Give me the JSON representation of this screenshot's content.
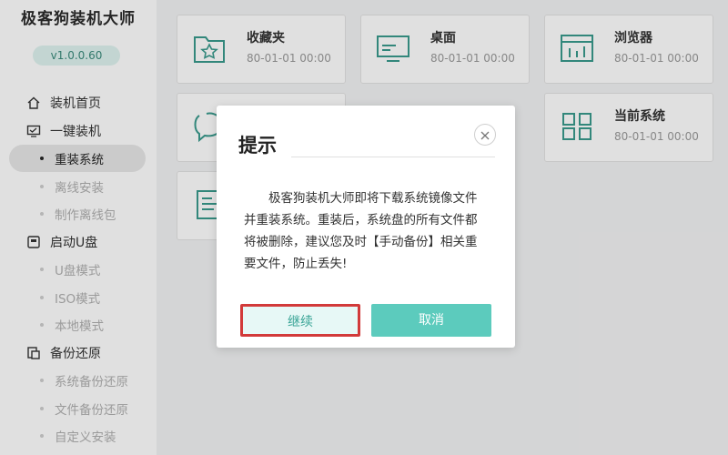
{
  "app": {
    "title": "极客狗装机大师",
    "version": "v1.0.0.60"
  },
  "sidebar": {
    "items": [
      {
        "label": "装机首页",
        "kind": "group",
        "icon": "home-icon"
      },
      {
        "label": "一键装机",
        "kind": "group",
        "icon": "monitor-icon"
      },
      {
        "label": "重装系统",
        "kind": "sub",
        "active": true
      },
      {
        "label": "离线安装",
        "kind": "sub"
      },
      {
        "label": "制作离线包",
        "kind": "sub"
      },
      {
        "label": "启动U盘",
        "kind": "group",
        "icon": "usb-icon"
      },
      {
        "label": "U盘模式",
        "kind": "sub"
      },
      {
        "label": "ISO模式",
        "kind": "sub"
      },
      {
        "label": "本地模式",
        "kind": "sub"
      },
      {
        "label": "备份还原",
        "kind": "group",
        "icon": "backup-icon"
      },
      {
        "label": "系统备份还原",
        "kind": "sub"
      },
      {
        "label": "文件备份还原",
        "kind": "sub"
      },
      {
        "label": "自定义安装",
        "kind": "sub"
      }
    ]
  },
  "main": {
    "cards": [
      {
        "name": "收藏夹",
        "date": "80-01-01 00:00",
        "icon": "favorites-icon"
      },
      {
        "name": "桌面",
        "date": "80-01-01 00:00",
        "icon": "desktop-icon"
      },
      {
        "name": "浏览器",
        "date": "80-01-01 00:00",
        "icon": "browser-icon"
      },
      {
        "name": "当前系统",
        "date": "80-01-01 00:00",
        "icon": "grid-icon"
      }
    ]
  },
  "dialog": {
    "title": "提示",
    "message": "极客狗装机大师即将下载系统镜像文件并重装系统。重装后，系统盘的所有文件都将被删除，建议您及时【手动备份】相关重要文件，防止丢失!",
    "continue_label": "继续",
    "cancel_label": "取消"
  },
  "colors": {
    "accent": "#5ccbbd",
    "highlight_border": "#d23a3a"
  }
}
